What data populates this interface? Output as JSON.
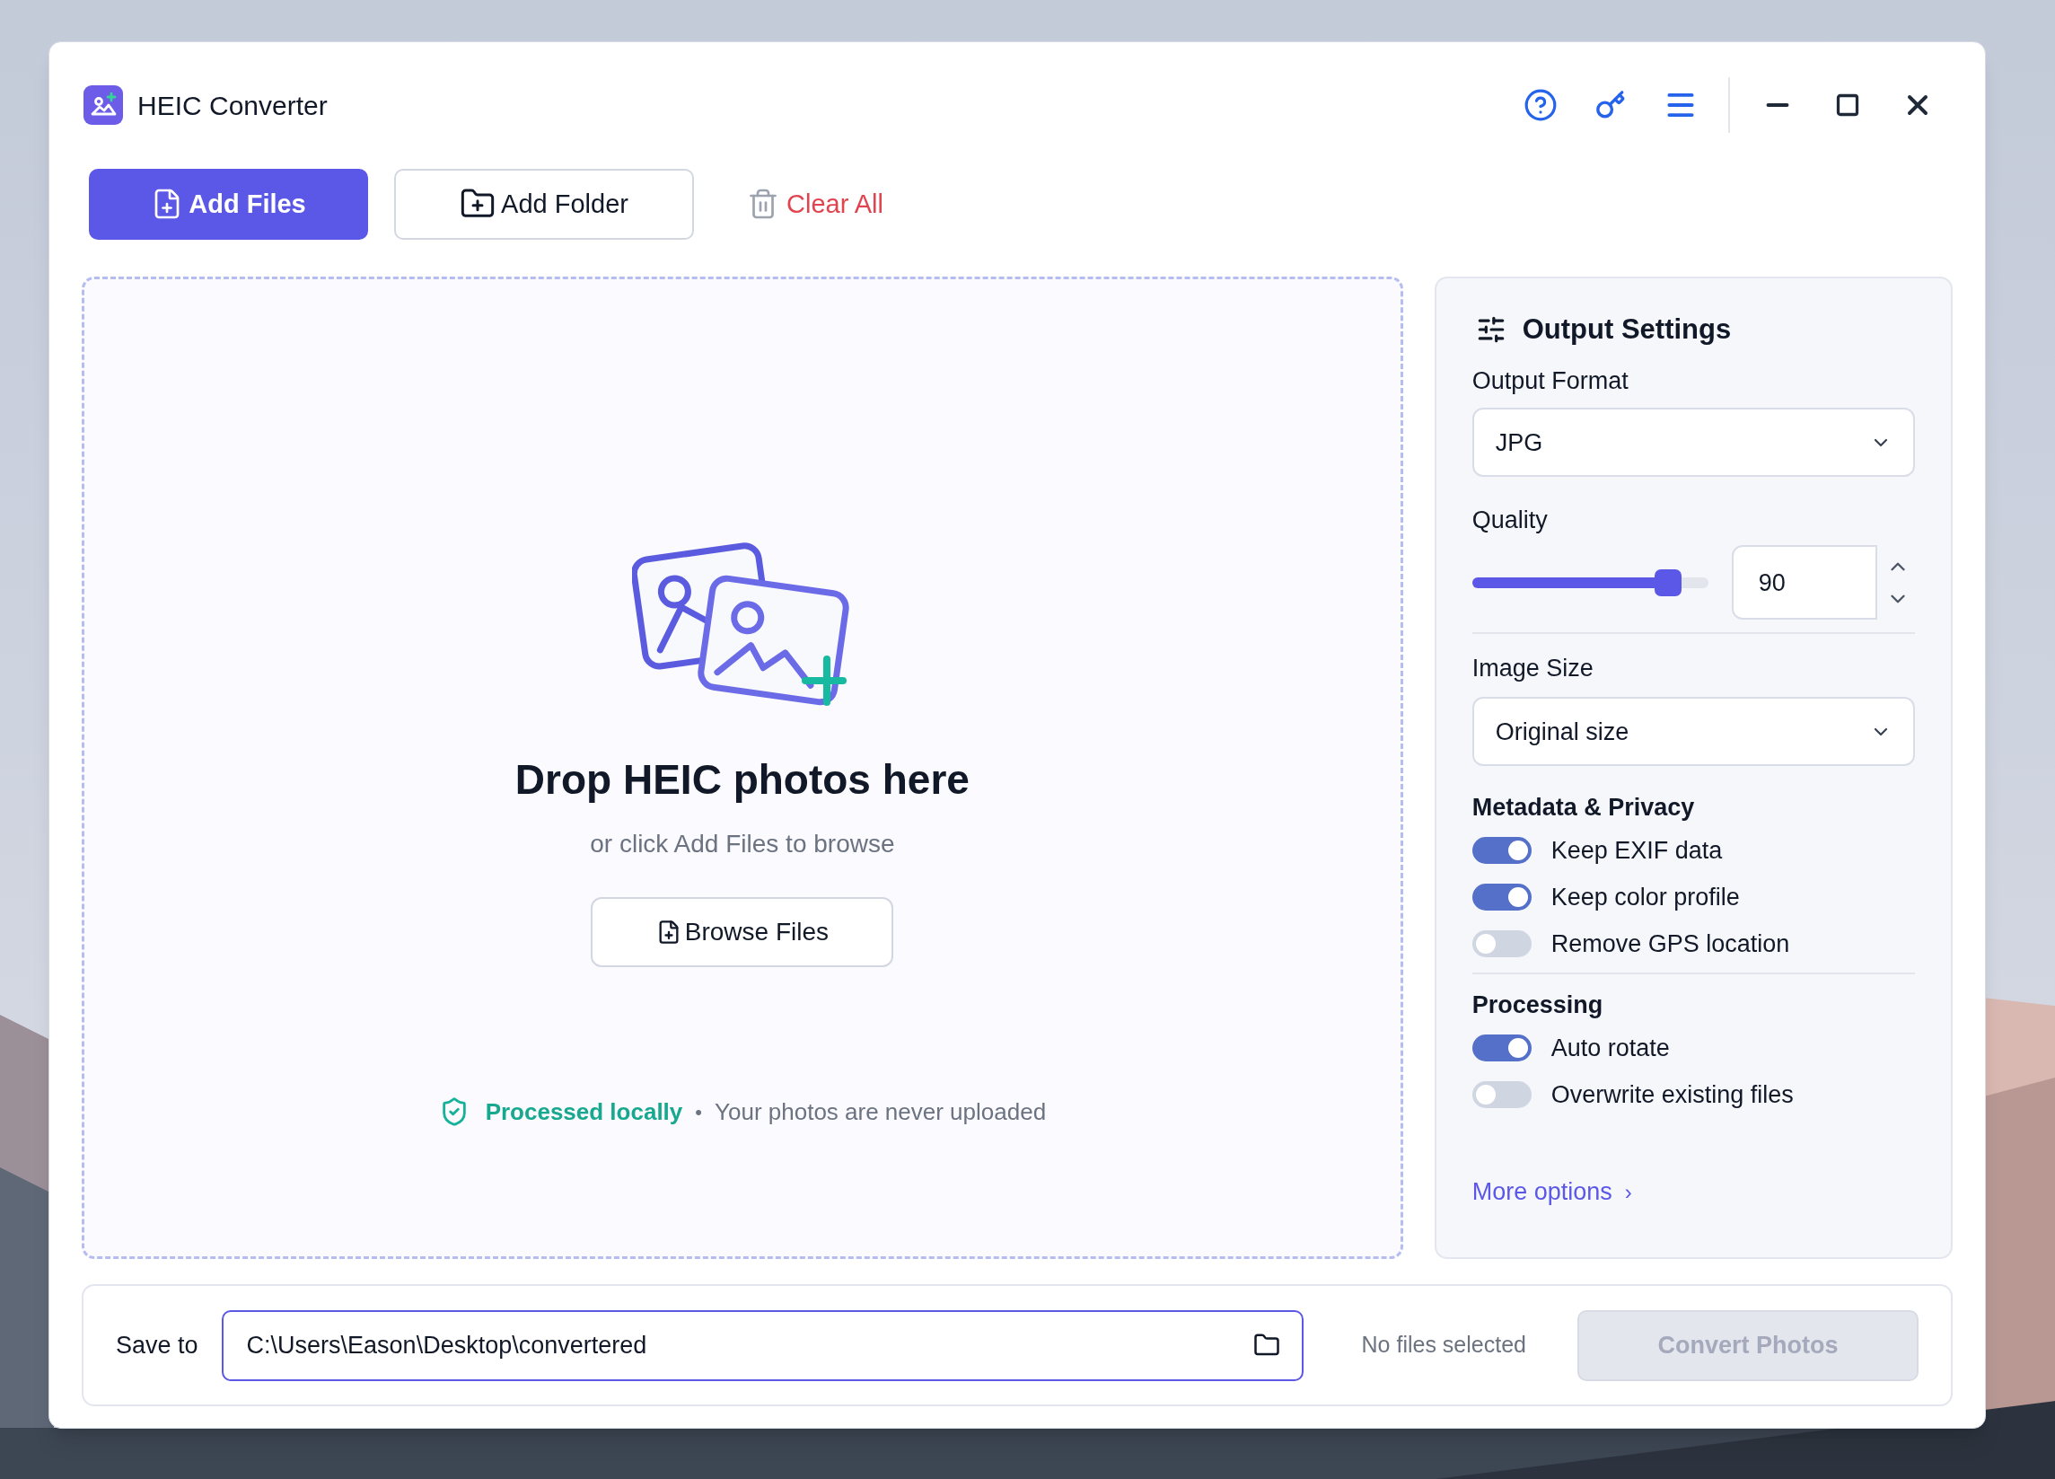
{
  "app": {
    "title": "HEIC Converter"
  },
  "toolbar": {
    "add_files": "Add Files",
    "add_folder": "Add Folder",
    "clear_all": "Clear All"
  },
  "drop_zone": {
    "heading": "Drop HEIC photos here",
    "subtext": "or click Add Files to browse",
    "browse_button": "Browse Files",
    "local_note": "Processed locally",
    "separator": "•",
    "privacy_note": "Your photos are never uploaded"
  },
  "settings": {
    "title": "Output Settings",
    "format_label": "Output Format",
    "format_value": "JPG",
    "quality_label": "Quality",
    "quality": {
      "level": 0.84,
      "value": "90"
    },
    "size_label": "Image Size",
    "size_value": "Original size",
    "sections": [
      {
        "title": "Metadata & Privacy",
        "toggles": [
          {
            "label": "Keep EXIF data",
            "on": true
          },
          {
            "label": "Keep color profile",
            "on": true
          },
          {
            "label": "Remove GPS location",
            "on": false
          }
        ]
      },
      {
        "title": "Processing",
        "toggles": [
          {
            "label": "Auto rotate",
            "on": true
          },
          {
            "label": "Overwrite existing files",
            "on": false
          }
        ]
      }
    ],
    "more_options": "More options",
    "more_chevron": "›"
  },
  "footer": {
    "save_label": "Save to",
    "path": "C:\\Users\\Eason\\Desktop\\convertered",
    "status": "No files selected",
    "convert_button": "Convert Photos",
    "convert_disabled": true
  }
}
